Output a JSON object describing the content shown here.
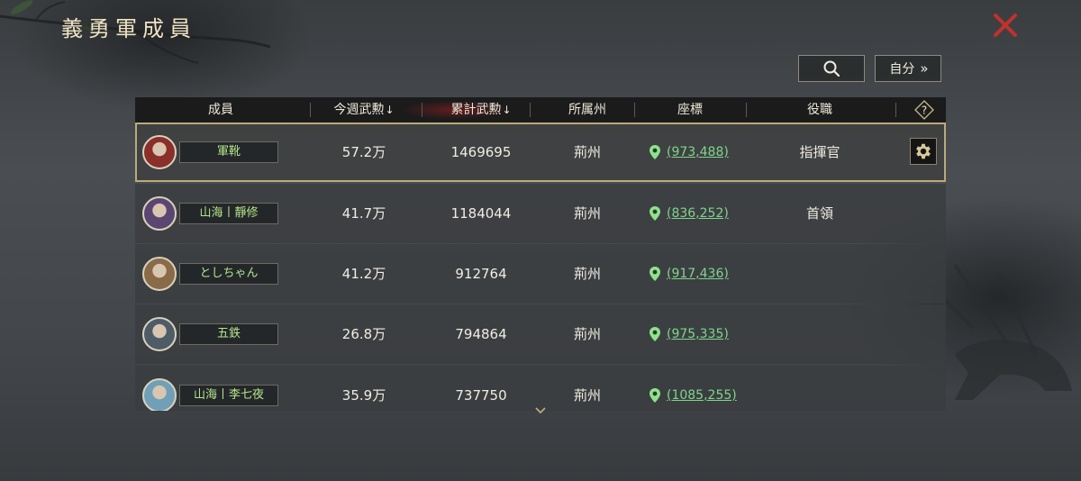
{
  "title": "義勇軍成員",
  "toolbar": {
    "search_icon": "search-icon",
    "self_label": "自分",
    "self_chevron": "»"
  },
  "table": {
    "headers": {
      "member": "成員",
      "weekly": "今週武勲",
      "weekly_sort": "↓",
      "total": "累計武勲",
      "total_sort": "↓",
      "province": "所属州",
      "coords": "座標",
      "role": "役職",
      "help": "?"
    },
    "rows": [
      {
        "name": "軍靴",
        "weekly": "57.2万",
        "total": "1469695",
        "province": "荊州",
        "coords": "(973,488)",
        "role": "指揮官",
        "avatar_color": "#8a2f2a"
      },
      {
        "name": "山海丨靜修",
        "weekly": "41.7万",
        "total": "1184044",
        "province": "荊州",
        "coords": "(836,252)",
        "role": "首領",
        "avatar_color": "#5a4670"
      },
      {
        "name": "としちゃん",
        "weekly": "41.2万",
        "total": "912764",
        "province": "荊州",
        "coords": "(917,436)",
        "role": "",
        "avatar_color": "#8a6a48"
      },
      {
        "name": "五鉄",
        "weekly": "26.8万",
        "total": "794864",
        "province": "荊州",
        "coords": "(975,335)",
        "role": "",
        "avatar_color": "#4e5c68"
      },
      {
        "name": "山海丨李七夜",
        "weekly": "35.9万",
        "total": "737750",
        "province": "荊州",
        "coords": "(1085,255)",
        "role": "",
        "avatar_color": "#6fa0b8"
      }
    ]
  },
  "colors": {
    "accent_green": "#7fd58e",
    "name_green": "#b4e58a",
    "close_red": "#c4302c",
    "selected_border": "#b8ab7a"
  }
}
